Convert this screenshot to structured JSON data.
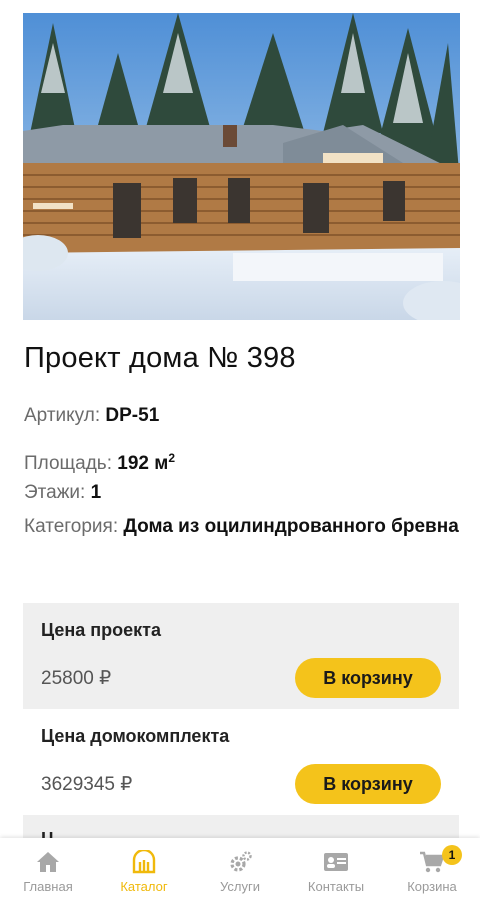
{
  "product": {
    "title": "Проект дома № 398",
    "specs": {
      "article_label": "Артикул:",
      "article_value": "DP-51",
      "area_label": "Площадь:",
      "area_value": "192 м",
      "area_unit_sup": "2",
      "floors_label": "Этажи:",
      "floors_value": "1",
      "category_label": "Категория:",
      "category_value": "Дома из оцилиндрованного бревна"
    }
  },
  "prices": [
    {
      "label": "Цена проекта",
      "amount": "25800 ₽",
      "button": "В корзину"
    },
    {
      "label": "Цена домокомплекта",
      "amount": "3629345 ₽",
      "button": "В корзину"
    },
    {
      "label": "Ц"
    }
  ],
  "bottom_nav": {
    "items": [
      {
        "label": "Главная",
        "icon": "home-icon"
      },
      {
        "label": "Каталог",
        "icon": "catalog-icon"
      },
      {
        "label": "Услуги",
        "icon": "gears-icon"
      },
      {
        "label": "Контакты",
        "icon": "contact-card-icon"
      },
      {
        "label": "Корзина",
        "icon": "cart-icon"
      }
    ],
    "active_index": 1,
    "cart_count": "1"
  },
  "colors": {
    "accent": "#f4c31b",
    "active_nav": "#f0b90b",
    "card_bg": "#efefef"
  }
}
